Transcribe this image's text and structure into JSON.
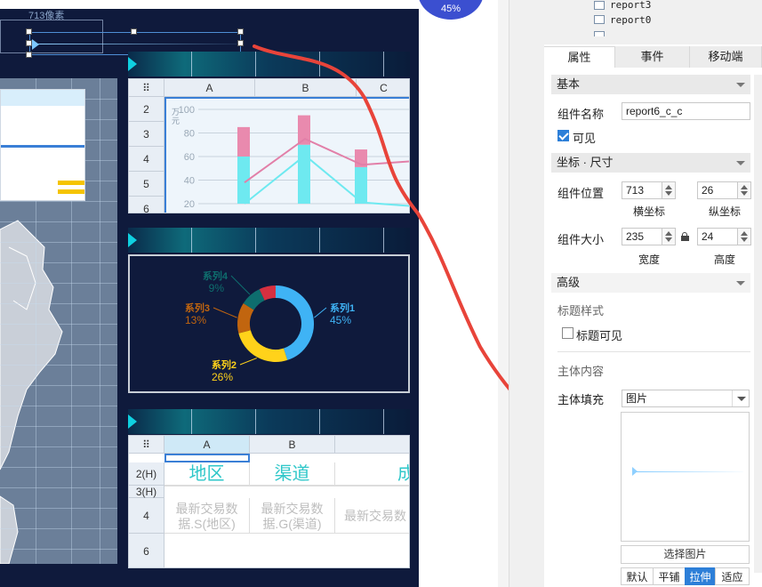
{
  "canvas": {
    "ruler_label": "713像素",
    "badge_text": "45%"
  },
  "sheet1": {
    "col_headers": [
      "A",
      "B",
      "C"
    ],
    "row_headers": [
      "2",
      "3",
      "4",
      "5",
      "6"
    ],
    "y_axis_unit": "万\n元"
  },
  "chart_data": [
    {
      "type": "bar",
      "categories": [
        "",
        "",
        ""
      ],
      "ylim": [
        20,
        100
      ],
      "yticks": [
        100,
        80,
        60,
        40,
        20
      ],
      "series": [
        {
          "values": [
            40,
            50,
            31
          ],
          "color": "#6ee9f0"
        },
        {
          "values": [
            25,
            25,
            15
          ],
          "color": "#e98aae"
        }
      ],
      "lines": [
        {
          "values": [
            38,
            75,
            53,
            56
          ],
          "color": "#e27fa8"
        },
        {
          "values": [
            20,
            61,
            21,
            18
          ],
          "color": "#6ee9f0"
        }
      ]
    },
    {
      "type": "pie",
      "series": [
        {
          "name": "系列1",
          "pct_label": "45%",
          "value": 45,
          "color": "#3fb3f5"
        },
        {
          "name": "系列2",
          "pct_label": "26%",
          "value": 26,
          "color": "#ffd21a"
        },
        {
          "name": "系列3",
          "pct_label": "13%",
          "value": 13,
          "color": "#c1650f"
        },
        {
          "name": "系列4",
          "pct_label": "9%",
          "value": 9,
          "color": "#0e6e6e"
        },
        {
          "name": "",
          "pct_label": "",
          "value": 7,
          "color": "#d63040"
        }
      ]
    }
  ],
  "sheet2": {
    "col_headers": [
      "A",
      "B"
    ],
    "row_headers": [
      "2(H)",
      "3(H)",
      "4",
      "6"
    ],
    "headers": [
      "地区",
      "渠道",
      "成"
    ],
    "cells": [
      "最新交易数据.S(地区)",
      "最新交易数据.G(渠道)",
      "最新交易数"
    ]
  },
  "tree": {
    "items": [
      "report3",
      "report0"
    ]
  },
  "panel": {
    "tabs": [
      "属性",
      "事件",
      "移动端"
    ],
    "section_basic": "基本",
    "name_label": "组件名称",
    "name_value": "report6_c_c",
    "visible_label": "可见",
    "section_coord": "坐标 · 尺寸",
    "pos_label": "组件位置",
    "x_value": "713",
    "y_value": "26",
    "x_caption": "横坐标",
    "y_caption": "纵坐标",
    "size_label": "组件大小",
    "w_value": "235",
    "h_value": "24",
    "w_caption": "宽度",
    "h_caption": "高度",
    "section_adv": "高级",
    "title_style": "标题样式",
    "title_visible": "标题可见",
    "body_content": "主体内容",
    "body_fill_label": "主体填充",
    "body_fill_value": "图片",
    "choose_image": "选择图片",
    "fit_options": [
      "默认",
      "平铺",
      "拉伸",
      "适应"
    ]
  },
  "colors": {
    "accent": "#2d7fd8",
    "dashboard_bg": "#0f1a3c",
    "annotation": "#e8443a"
  }
}
